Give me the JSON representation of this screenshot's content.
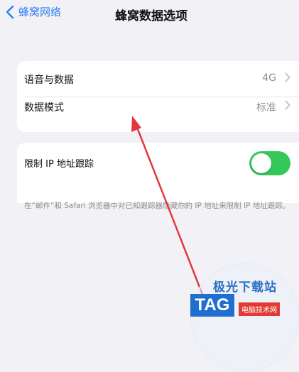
{
  "nav": {
    "back_label": "蜂窝网络",
    "title": "蜂窝数据选项"
  },
  "group1": {
    "row1": {
      "label": "语音与数据",
      "value": "4G"
    },
    "row2": {
      "label": "数据模式",
      "value": "标准"
    }
  },
  "group2": {
    "toggle_label": "限制 IP 地址跟踪",
    "toggle_on": true,
    "footnote": "在“邮件”和 Safari 浏览器中对已知跟踪器隐藏你的 IP 地址来限制 IP 地址跟踪。"
  },
  "watermark": {
    "site_text": "极光下载站",
    "badge": "TAG",
    "badge_caption": "电脑技术网"
  },
  "colors": {
    "accent": "#2f7cf6",
    "toggle_on": "#34c759",
    "arrow": "#e2373f"
  }
}
